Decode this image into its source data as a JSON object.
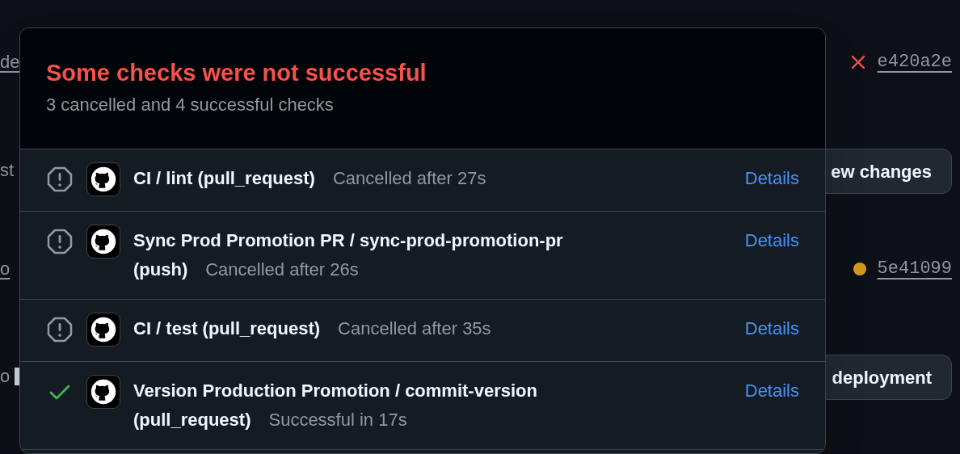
{
  "background": {
    "left_fragments": [
      {
        "text": "de",
        "underlined": true
      },
      {
        "text": "st",
        "underlined": false
      },
      {
        "text": "o",
        "underlined": true
      },
      {
        "text": "o",
        "underlined": false
      }
    ],
    "commits": [
      {
        "kind": "failure",
        "sha": "e420a2e"
      },
      {
        "kind": "pending",
        "sha": "5e41099"
      }
    ],
    "buttons": [
      "ew changes",
      "deployment"
    ]
  },
  "popup": {
    "title": "Some checks were not successful",
    "summary": "3 cancelled and 4 successful checks",
    "checks": [
      {
        "kind": "cancelled",
        "name": "CI / lint (pull_request)",
        "result": "Cancelled after 27s",
        "link": "Details"
      },
      {
        "kind": "cancelled",
        "name": "Sync Prod Promotion PR / sync-prod-promotion-pr (push)",
        "result": "Cancelled after 26s",
        "link": "Details"
      },
      {
        "kind": "cancelled",
        "name": "CI / test (pull_request)",
        "result": "Cancelled after 35s",
        "link": "Details"
      },
      {
        "kind": "success",
        "name": "Version Production Promotion / commit-version (pull_request)",
        "result": "Successful in 17s",
        "link": "Details"
      }
    ]
  }
}
